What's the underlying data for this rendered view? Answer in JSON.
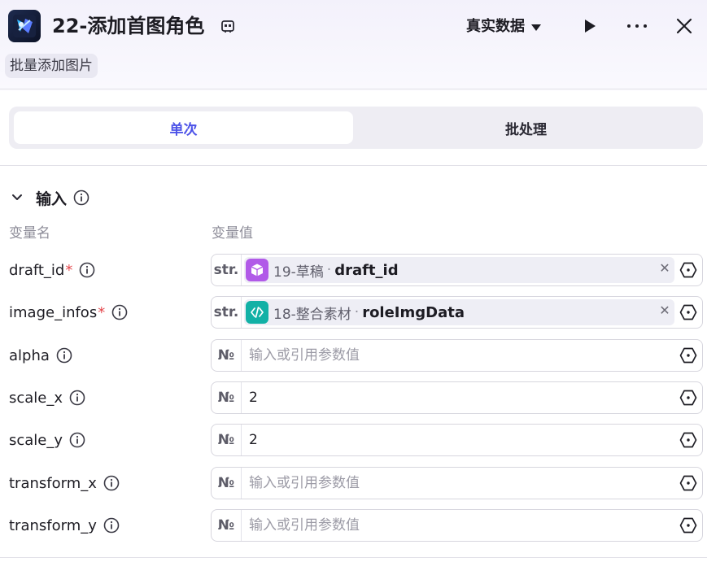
{
  "header": {
    "title": "22-添加首图角色",
    "subtitle": "批量添加图片",
    "data_mode": "真实数据",
    "icons": [
      "app-icon",
      "edit-title-icon",
      "run-icon",
      "more-icon",
      "close-icon"
    ]
  },
  "tabs": [
    {
      "label": "单次",
      "active": true
    },
    {
      "label": "批处理",
      "active": false
    }
  ],
  "section": {
    "title": "输入",
    "col_name": "变量名",
    "col_value": "变量值"
  },
  "fields": [
    {
      "name": "draft_id",
      "required": "*",
      "type": "str.",
      "ref_node": "19-草稿",
      "ref_sep": "·",
      "ref_var": "draft_id",
      "ref_color": "#b15ae8"
    },
    {
      "name": "image_infos",
      "required": "*",
      "type": "str.",
      "ref_node": "18-整合素材",
      "ref_sep": "·",
      "ref_var": "roleImgData",
      "ref_color": "#12b1a6"
    },
    {
      "name": "alpha",
      "type": "№",
      "value": "",
      "placeholder": "输入或引用参数值"
    },
    {
      "name": "scale_x",
      "type": "№",
      "value": "2",
      "placeholder": "输入或引用参数值"
    },
    {
      "name": "scale_y",
      "type": "№",
      "value": "2",
      "placeholder": "输入或引用参数值"
    },
    {
      "name": "transform_x",
      "type": "№",
      "value": "",
      "placeholder": "输入或引用参数值"
    },
    {
      "name": "transform_y",
      "type": "№",
      "value": "",
      "placeholder": "输入或引用参数值"
    }
  ],
  "colors": {
    "accent": "#4d53e8",
    "required": "#e5484d"
  }
}
